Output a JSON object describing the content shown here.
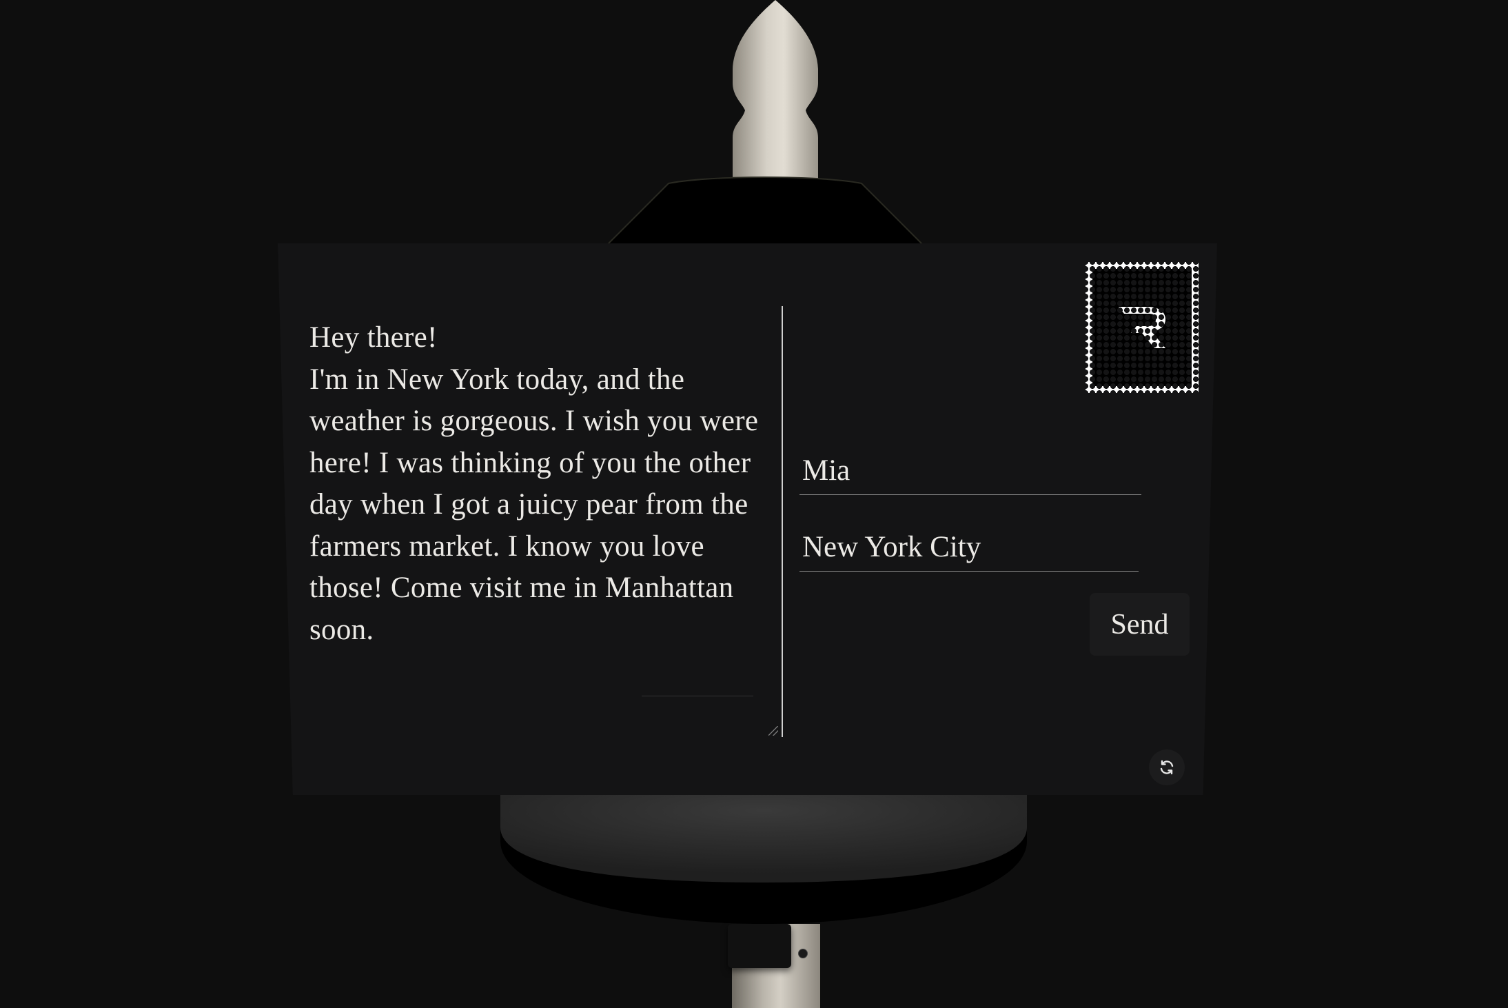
{
  "postcard": {
    "message": "Hey there!\nI'm in New York today, and the weather is gorgeous. I wish you were here! I was thinking of you the other day when I got a juicy pear from the farmers market. I know you love those! Come visit me in Manhattan soon.",
    "recipient_name": "Mia",
    "recipient_city": "New York City",
    "send_label": "Send",
    "stamp_icon": "r-logo-icon",
    "refresh_icon": "refresh-icon"
  },
  "colors": {
    "background": "#0e0e0e",
    "card": "#141415",
    "text": "#eceae6",
    "button": "#1b1b1c"
  }
}
